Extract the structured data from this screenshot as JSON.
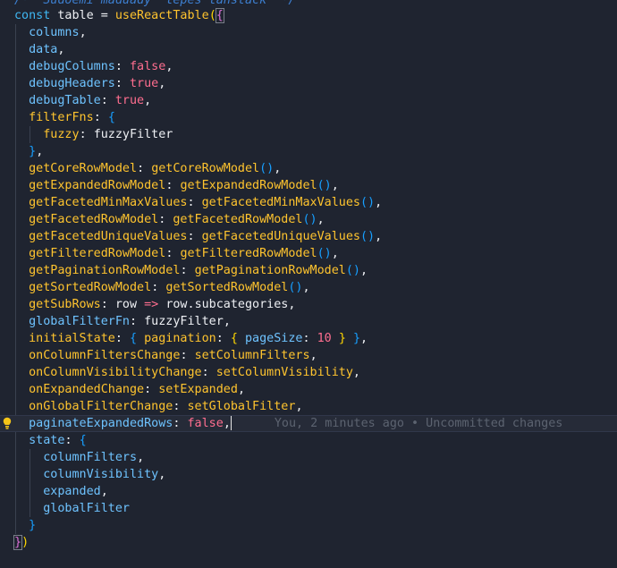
{
  "comment_line": "/*  Sudoemi maduady 'lepes tanstack' */",
  "lines": [
    "const table = useReactTable({",
    "columns,",
    "data,",
    "debugColumns: false,",
    "debugHeaders: true,",
    "debugTable: true,",
    "filterFns: {",
    "fuzzy: fuzzyFilter",
    "},",
    "getCoreRowModel: getCoreRowModel(),",
    "getExpandedRowModel: getExpandedRowModel(),",
    "getFacetedMinMaxValues: getFacetedMinMaxValues(),",
    "getFacetedRowModel: getFacetedRowModel(),",
    "getFacetedUniqueValues: getFacetedUniqueValues(),",
    "getFilteredRowModel: getFilteredRowModel(),",
    "getPaginationRowModel: getPaginationRowModel(),",
    "getSortedRowModel: getSortedRowModel(),",
    "getSubRows: row => row.subcategories,",
    "globalFilterFn: fuzzyFilter,",
    "initialState: { pagination: { pageSize: 10 } },",
    "onColumnFiltersChange: setColumnFilters,",
    "onColumnVisibilityChange: setColumnVisibility,",
    "onExpandedChange: setExpanded,",
    "onGlobalFilterChange: setGlobalFilter,",
    "paginateExpandedRows: false,",
    "state: {",
    "columnFilters,",
    "columnVisibility,",
    "expanded,",
    "globalFilter",
    "}",
    "})"
  ],
  "blame": "You, 2 minutes ago • Uncommitted changes",
  "icons": {
    "lightbulb": "lightbulb-icon"
  },
  "colors": {
    "background": "#1f2430",
    "keyword": "#3fb7f2",
    "function": "#ffc42e",
    "property": "#6ec3ff",
    "value": "#ff6e8f",
    "lightbulb": "#f5c518"
  }
}
